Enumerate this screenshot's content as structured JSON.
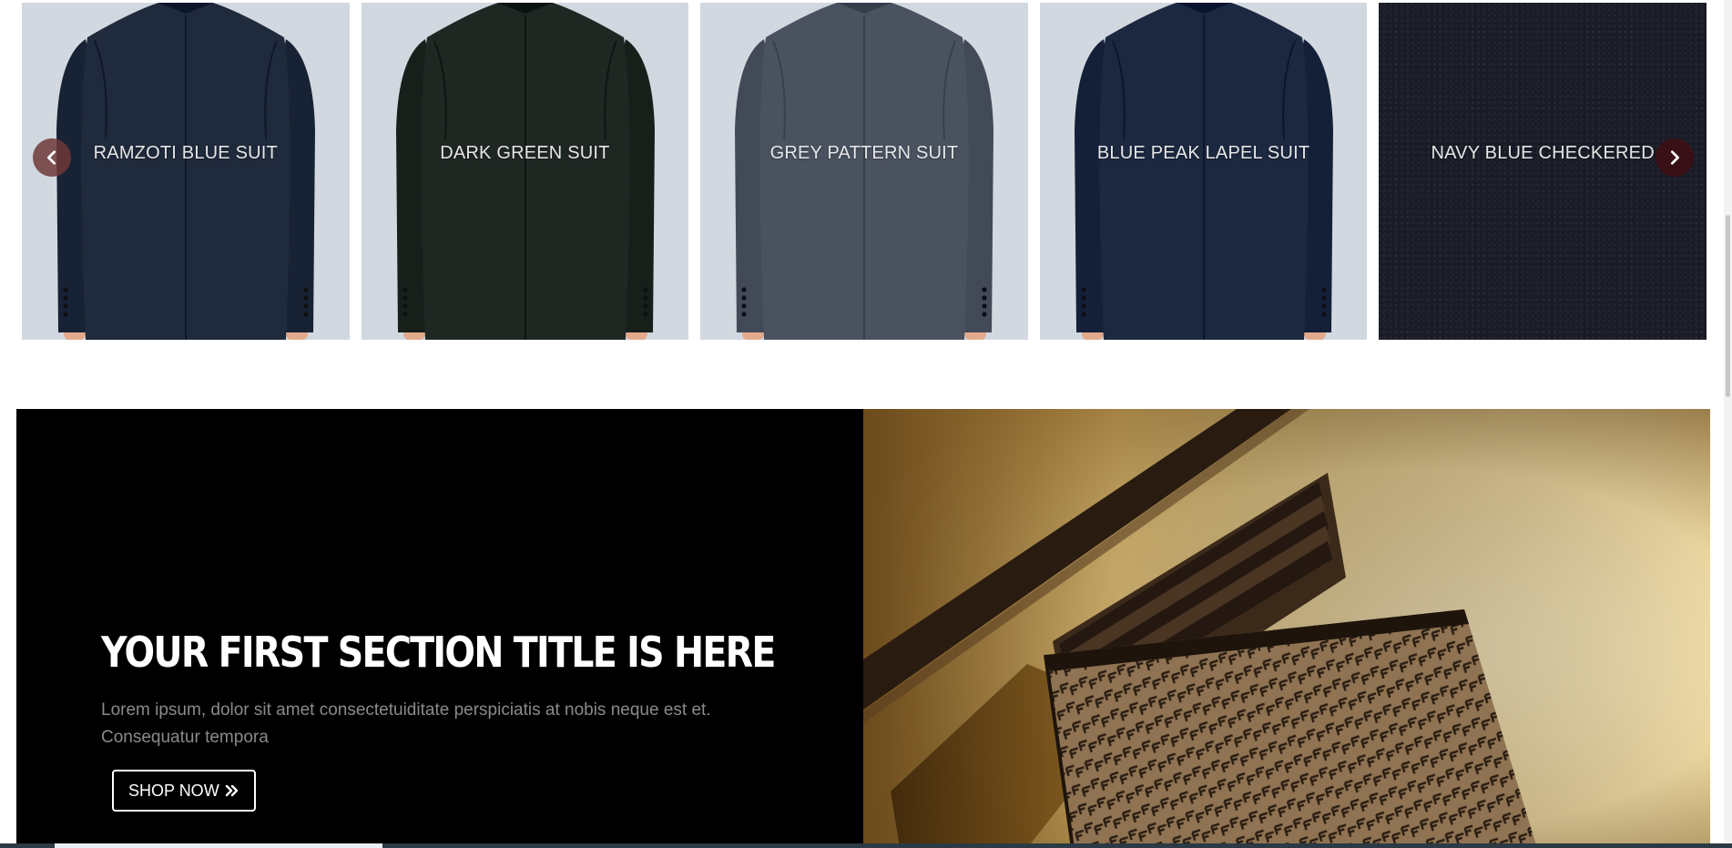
{
  "carousel": {
    "prev_icon": "chevron-left-icon",
    "next_icon": "chevron-right-icon",
    "items": [
      {
        "title": "RAMZOTI BLUE SUIT",
        "color": "#1f2a3c"
      },
      {
        "title": "DARK GREEN SUIT",
        "color": "#1f2723"
      },
      {
        "title": "GREY PATTERN SUIT",
        "color": "#4a5260"
      },
      {
        "title": "BLUE PEAK LAPEL SUIT",
        "color": "#1c2840"
      },
      {
        "title": "NAVY BLUE CHECKERED",
        "color": "#191b27"
      }
    ]
  },
  "promo": {
    "title": "YOUR FIRST SECTION TITLE IS HERE",
    "text": "Lorem ipsum, dolor sit amet consectetuiditate perspiciatis at nobis neque est et. Consequatur tempora",
    "button_label": "SHOP NOW",
    "button_icon": "double-chevron-right-icon"
  },
  "colors": {
    "card_background": "#d1d8df",
    "promo_left_background": "#000000",
    "prev_button": "#6e383a",
    "next_button": "#3a1014"
  }
}
